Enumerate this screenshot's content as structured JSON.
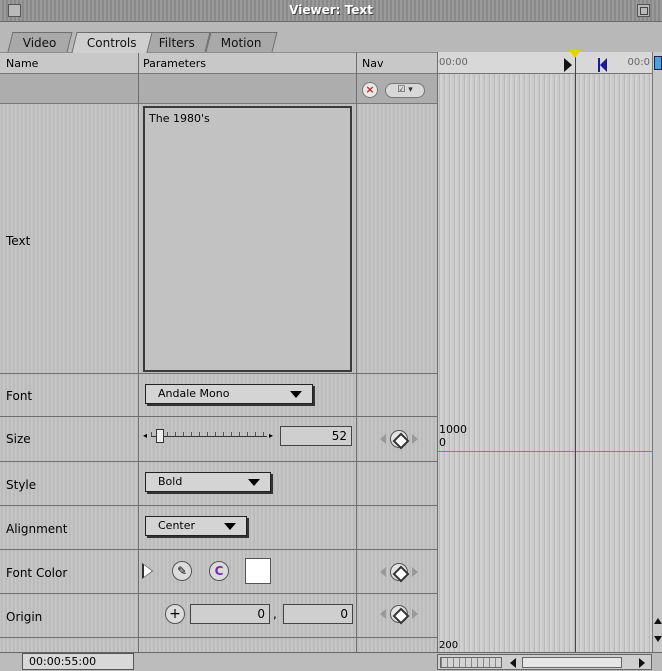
{
  "window": {
    "title": "Viewer: Text"
  },
  "tabs": [
    {
      "label": "Video"
    },
    {
      "label": "Controls"
    },
    {
      "label": "Filters"
    },
    {
      "label": "Motion"
    }
  ],
  "columns": {
    "name": "Name",
    "parameters": "Parameters",
    "nav": "Nav"
  },
  "timeline": {
    "start": "00:00",
    "end": "00:0"
  },
  "params": {
    "text": {
      "label": "Text",
      "value": "The 1980's"
    },
    "font": {
      "label": "Font",
      "value": "Andale Mono"
    },
    "size": {
      "label": "Size",
      "value": "52",
      "slider_fraction": 0.05,
      "graph_top": "1000",
      "graph_bottom": "0"
    },
    "style": {
      "label": "Style",
      "value": "Bold"
    },
    "alignment": {
      "label": "Alignment",
      "value": "Center"
    },
    "font_color": {
      "label": "Font Color",
      "swatch": "#ffffff"
    },
    "origin": {
      "label": "Origin",
      "x": "0",
      "y": "0",
      "sep": ","
    },
    "partial": {
      "graph_top": "200"
    }
  },
  "icons": {
    "reset": "reset-x-icon",
    "eyedropper": "eyedropper-icon",
    "color_picker": "color-wheel-icon",
    "keyframe": "keyframe-diamond-icon",
    "crosshair": "crosshair-icon"
  },
  "status": {
    "timecode": "00:00:55:00"
  },
  "colors": {
    "graph_line": "#3bb53b",
    "playhead": "#e6d200",
    "out_marker": "#1a1a9c"
  }
}
